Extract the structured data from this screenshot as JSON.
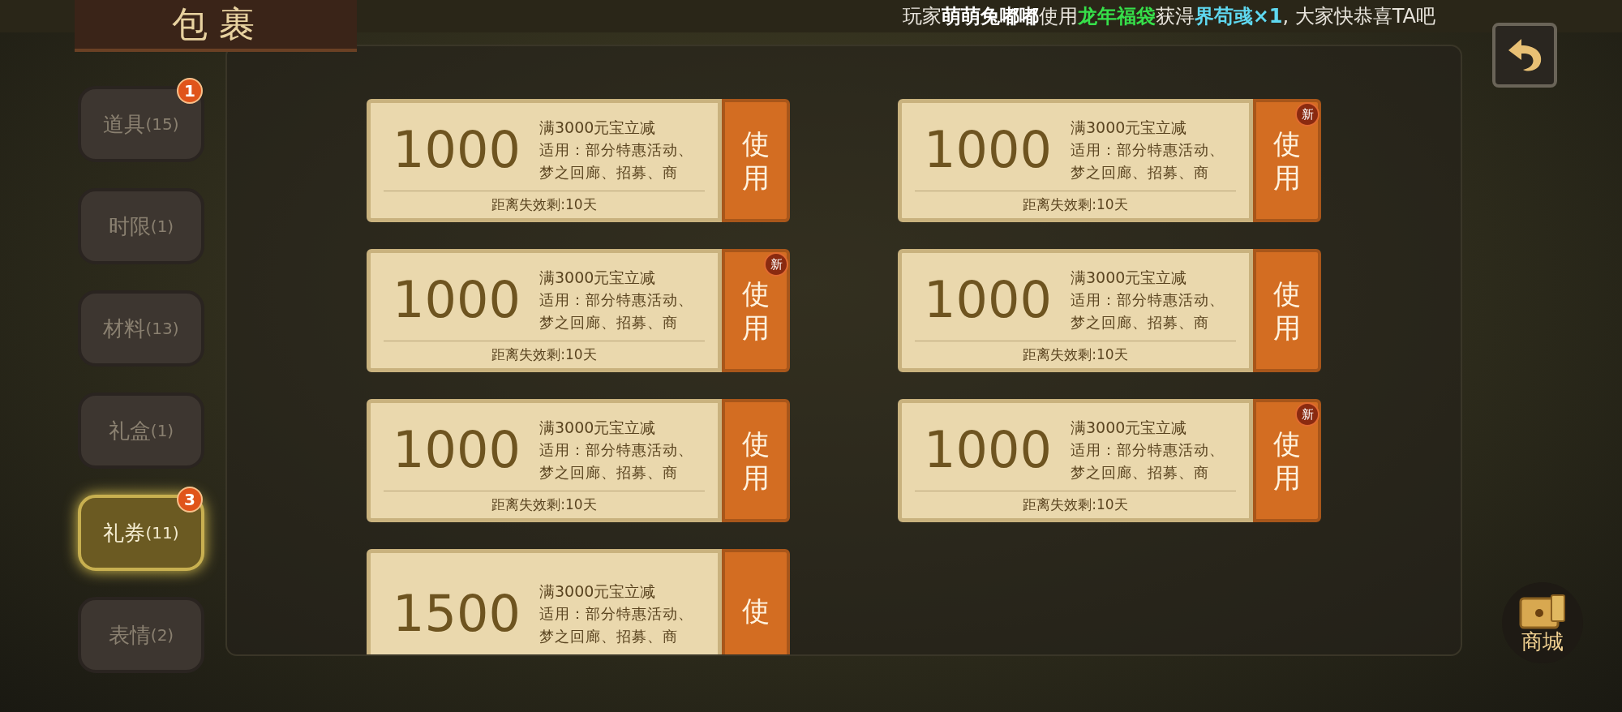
{
  "title": "包裹",
  "ticker": [
    {
      "text": "玩家",
      "color": "#e8e4dc",
      "bold": false
    },
    {
      "text": "萌萌兔嘟嘟",
      "color": "#ffffff",
      "bold": true
    },
    {
      "text": "使用",
      "color": "#e8e4dc",
      "bold": false
    },
    {
      "text": "龙年福袋",
      "color": "#36e04a",
      "bold": true
    },
    {
      "text": "获淂",
      "color": "#e8e4dc",
      "bold": false
    },
    {
      "text": "界苟彧×1",
      "color": "#5fd8f0",
      "bold": true
    },
    {
      "text": ", 大家快恭喜TA吧",
      "color": "#e8e4dc",
      "bold": false
    }
  ],
  "tabs": [
    {
      "label": "道具",
      "count": "(15)",
      "selected": false,
      "badge": "1"
    },
    {
      "label": "时限",
      "count": "(1)",
      "selected": false
    },
    {
      "label": "材料",
      "count": "(13)",
      "selected": false
    },
    {
      "label": "礼盒",
      "count": "(1)",
      "selected": false
    },
    {
      "label": "礼券",
      "count": "(11)",
      "selected": true,
      "badge": "3"
    },
    {
      "label": "表情",
      "count": "(2)",
      "selected": false
    }
  ],
  "coupons": [
    {
      "amount": "1000",
      "condition": "满3000元宝立减",
      "scope": [
        "适用：部分特惠活动、",
        "梦之回廊、招募、商"
      ],
      "expiry": "距离失效剩:10天",
      "button": [
        "使",
        "用"
      ],
      "new_badge": false
    },
    {
      "amount": "1000",
      "condition": "满3000元宝立减",
      "scope": [
        "适用：部分特惠活动、",
        "梦之回廊、招募、商"
      ],
      "expiry": "距离失效剩:10天",
      "button": [
        "使",
        "用"
      ],
      "new_badge": true,
      "badge_text": "新"
    },
    {
      "amount": "1000",
      "condition": "满3000元宝立减",
      "scope": [
        "适用：部分特惠活动、",
        "梦之回廊、招募、商"
      ],
      "expiry": "距离失效剩:10天",
      "button": [
        "使",
        "用"
      ],
      "new_badge": true,
      "badge_text": "新"
    },
    {
      "amount": "1000",
      "condition": "满3000元宝立减",
      "scope": [
        "适用：部分特惠活动、",
        "梦之回廊、招募、商"
      ],
      "expiry": "距离失效剩:10天",
      "button": [
        "使",
        "用"
      ],
      "new_badge": false
    },
    {
      "amount": "1000",
      "condition": "满3000元宝立减",
      "scope": [
        "适用：部分特惠活动、",
        "梦之回廊、招募、商"
      ],
      "expiry": "距离失效剩:10天",
      "button": [
        "使",
        "用"
      ],
      "new_badge": false
    },
    {
      "amount": "1000",
      "condition": "满3000元宝立减",
      "scope": [
        "适用：部分特惠活动、",
        "梦之回廊、招募、商"
      ],
      "expiry": "距离失效剩:10天",
      "button": [
        "使",
        "用"
      ],
      "new_badge": true,
      "badge_text": "新"
    },
    {
      "amount": "1500",
      "condition": "满3000元宝立减",
      "scope": [
        "适用：部分特惠活动、",
        "梦之回廊、招募、商"
      ],
      "button": [
        "使"
      ],
      "new_badge": false
    }
  ],
  "shop": {
    "label": "商城"
  }
}
